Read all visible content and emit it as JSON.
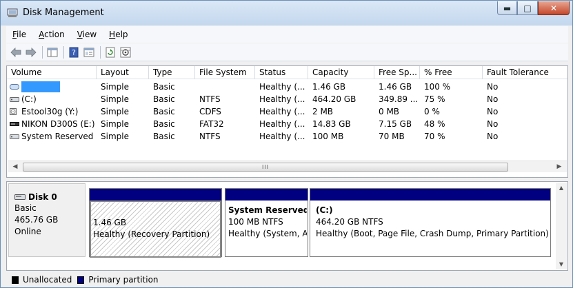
{
  "window": {
    "title": "Disk Management"
  },
  "menu": [
    {
      "key": "F",
      "rest": "ile"
    },
    {
      "key": "A",
      "rest": "ction"
    },
    {
      "key": "V",
      "rest": "iew"
    },
    {
      "key": "H",
      "rest": "elp"
    }
  ],
  "toolbar": [
    "back-icon",
    "forward-icon",
    "console-tree-icon",
    "help-icon",
    "properties-icon",
    "refresh-icon",
    "rescan-disks-icon"
  ],
  "columns": [
    "Volume",
    "Layout",
    "Type",
    "File System",
    "Status",
    "Capacity",
    "Free Sp...",
    "% Free",
    "Fault Tolerance"
  ],
  "volumes": [
    {
      "name": "",
      "layout": "Simple",
      "type": "Basic",
      "fs": "",
      "status": "Healthy (...",
      "capacity": "1.46 GB",
      "free": "1.46 GB",
      "pct": "100 %",
      "fault": "No",
      "icon": "volume-icon",
      "redacted": true
    },
    {
      "name": "(C:)",
      "layout": "Simple",
      "type": "Basic",
      "fs": "NTFS",
      "status": "Healthy (...",
      "capacity": "464.20 GB",
      "free": "349.89 ...",
      "pct": "75 %",
      "fault": "No",
      "icon": "hard-drive-icon"
    },
    {
      "name": "Estool30g (Y:)",
      "layout": "Simple",
      "type": "Basic",
      "fs": "CDFS",
      "status": "Healthy (...",
      "capacity": "2 MB",
      "free": "0 MB",
      "pct": "0 %",
      "fault": "No",
      "icon": "cd-drive-icon"
    },
    {
      "name": "NIKON D300S (E:)",
      "layout": "Simple",
      "type": "Basic",
      "fs": "FAT32",
      "status": "Healthy (...",
      "capacity": "14.83 GB",
      "free": "7.15 GB",
      "pct": "48 %",
      "fault": "No",
      "icon": "removable-drive-icon"
    },
    {
      "name": "System Reserved",
      "layout": "Simple",
      "type": "Basic",
      "fs": "NTFS",
      "status": "Healthy (...",
      "capacity": "100 MB",
      "free": "70 MB",
      "pct": "70 %",
      "fault": "No",
      "icon": "hard-drive-icon"
    }
  ],
  "scroll_grip": "III",
  "disk": {
    "name": "Disk 0",
    "type": "Basic",
    "size": "465.76 GB",
    "status": "Online",
    "partitions": [
      {
        "name": "",
        "size": "1.46 GB",
        "status": "Healthy (Recovery Partition)"
      },
      {
        "name": "System Reserved",
        "size": "100 MB NTFS",
        "status": "Healthy (System, A"
      },
      {
        "name": "(C:)",
        "size": "464.20 GB NTFS",
        "status": "Healthy (Boot, Page File, Crash Dump, Primary Partition)"
      }
    ]
  },
  "legend": [
    {
      "label": "Unallocated",
      "color": "#000000"
    },
    {
      "label": "Primary partition",
      "color": "#000080"
    }
  ]
}
